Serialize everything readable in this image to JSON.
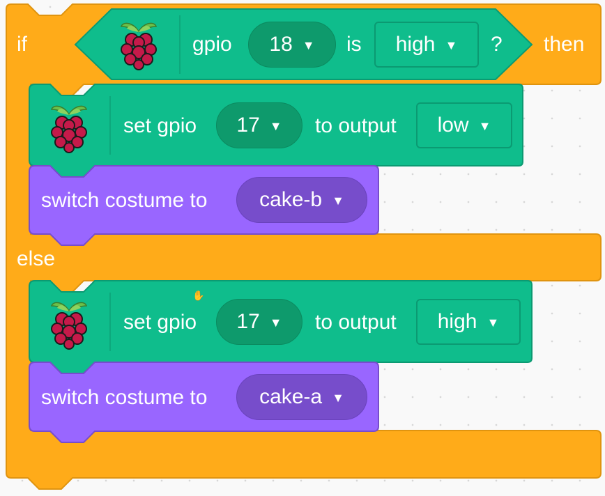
{
  "if_block": {
    "if_label": "if",
    "then_label": "then",
    "else_label": "else"
  },
  "condition": {
    "gpio_label": "gpio",
    "pin_value": "18",
    "is_label": "is",
    "state_value": "high",
    "question_label": "?"
  },
  "then_branch": {
    "set_gpio": {
      "set_label": "set gpio",
      "pin_value": "17",
      "output_label": "to output",
      "level_value": "low"
    },
    "costume": {
      "label": "switch costume to",
      "value": "cake-b"
    }
  },
  "else_branch": {
    "set_gpio": {
      "set_label": "set gpio",
      "pin_value": "17",
      "output_label": "to output",
      "level_value": "high"
    },
    "costume": {
      "label": "switch costume to",
      "value": "cake-a"
    }
  },
  "icons": {
    "extension_icon": "raspberry-pi-icon",
    "dropdown_icon": "caret-down-icon",
    "cursor_icon": "grab-hand-icon"
  },
  "colors": {
    "control_orange": "#ffab19",
    "control_orange_border": "#ec9c13",
    "extension_green": "#0fbd8c",
    "extension_green_border": "#0b9a72",
    "looks_purple": "#9966ff",
    "looks_purple_border": "#774dcb"
  }
}
